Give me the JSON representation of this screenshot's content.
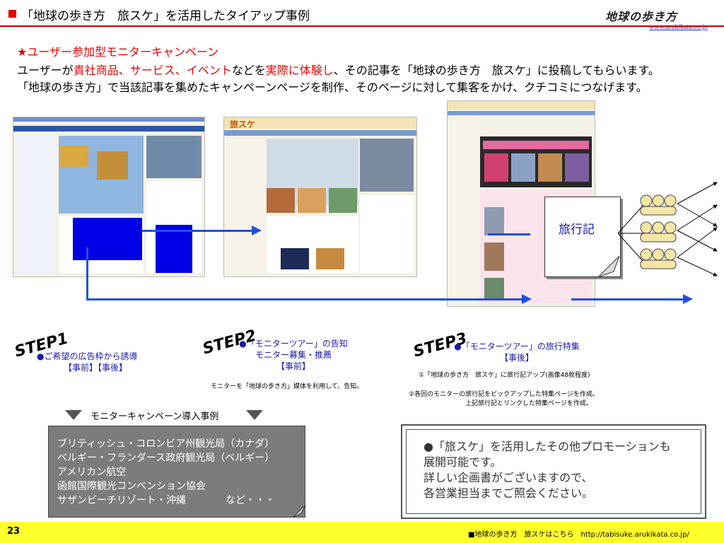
{
  "header": {
    "title": "「地球の歩き方　旅スケ」を活用したタイアップ事例",
    "logo": "地球の歩き方",
    "url": "www.arukikata.co.jp"
  },
  "campaign": {
    "title": "★ユーザー参加型モニターキャンペーン",
    "desc1_a": "ユーザーが",
    "desc1_red1": "貴社商品、サービス、イベント",
    "desc1_b": "などを",
    "desc1_red2": "実際に体験し",
    "desc1_c": "、その記事を「地球の歩き方　旅スケ」に投稿してもらいます。",
    "desc2": "「地球の歩き方」で当該記事を集めたキャンペーンページを制作、そのページに対して集客をかけ、クチコミにつなげます。"
  },
  "steps": {
    "step1": {
      "label": "STEP1",
      "line1": "●ご希望の広告枠から誘導",
      "line2": "【事前】【事後】"
    },
    "step2": {
      "label": "STEP2",
      "line1": "●「モニターツアー」の告知",
      "line2": "モニター募集・推薦",
      "line3": "【事前】",
      "note": "モニターを「地球の歩き方」媒体を利用して、告知。"
    },
    "step3": {
      "label": "STEP3",
      "line1": "●「モニターツアー」の旅行特集",
      "line2": "【事後】",
      "note1": "①「地球の歩き方　旅スケ」に旅行記アップ(画像48枚程度)",
      "note2": "②各回のモニターの旅行記をピックアップした特集ページを作成。",
      "note3": "上記旅行記とリンクした特集ページを作成。"
    }
  },
  "travelog_label": "旅行記",
  "screenshot_logo": "旅スケ",
  "intro_label": "モニターキャンペーン導入事例",
  "cases": [
    "ブリティッシュ・コロンビア州観光局（カナダ）",
    "ベルギー・フランダース政府観光局（ベルギー）",
    "アメリカン航空",
    "函館国際観光コンベンション協会",
    "サザンビーチリゾート・沖縄　　　　など・・・"
  ],
  "promo": [
    "●「旅スケ」を活用したその他プロモーションも",
    "展開可能です。",
    "詳しい企画書がございますので、",
    "各営業担当までご照会ください。"
  ],
  "footer": {
    "page_number": "23",
    "link": "■地球の歩き方　旅スケはこちら　http://tabisuke.arukikata.co.jp/"
  },
  "colors": {
    "accent_red": "#e60000",
    "arrow_blue": "#1f4fe0",
    "footer_yellow": "#ffff2b"
  }
}
